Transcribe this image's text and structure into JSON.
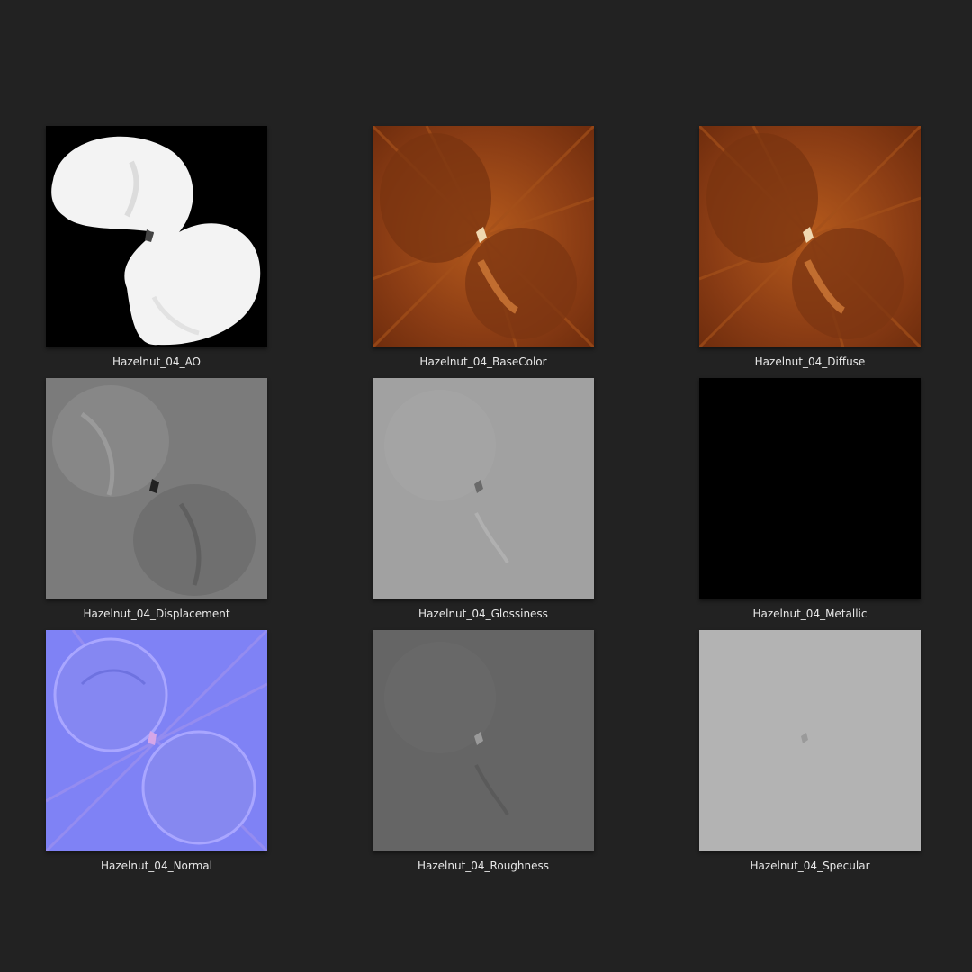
{
  "gallery": {
    "background": "#222222",
    "items": [
      {
        "label": "Hazelnut_04_AO",
        "kind": "ao"
      },
      {
        "label": "Hazelnut_04_BaseColor",
        "kind": "basecolor"
      },
      {
        "label": "Hazelnut_04_Diffuse",
        "kind": "diffuse"
      },
      {
        "label": "Hazelnut_04_Displacement",
        "kind": "displacement"
      },
      {
        "label": "Hazelnut_04_Glossiness",
        "kind": "glossiness"
      },
      {
        "label": "Hazelnut_04_Metallic",
        "kind": "metallic"
      },
      {
        "label": "Hazelnut_04_Normal",
        "kind": "normal"
      },
      {
        "label": "Hazelnut_04_Roughness",
        "kind": "roughness"
      },
      {
        "label": "Hazelnut_04_Specular",
        "kind": "specular"
      }
    ]
  }
}
